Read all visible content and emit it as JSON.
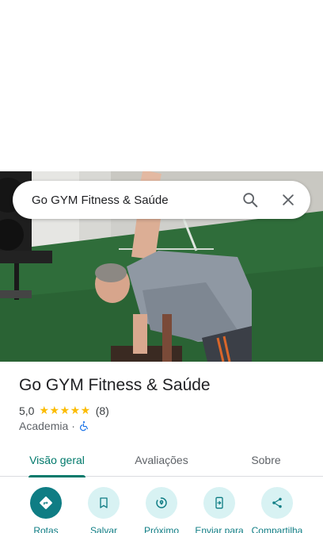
{
  "search": {
    "query": "Go GYM Fitness & Saúde",
    "search_icon": "search-icon",
    "close_icon": "close-icon"
  },
  "place": {
    "name": "Go GYM Fitness & Saúde",
    "rating": "5,0",
    "stars": "★★★★★",
    "review_count": "(8)",
    "category": "Academia",
    "separator": "·",
    "accessibility_icon": "wheelchair-icon"
  },
  "tabs": [
    {
      "label": "Visão geral",
      "active": true
    },
    {
      "label": "Avaliações",
      "active": false
    },
    {
      "label": "Sobre",
      "active": false
    }
  ],
  "actions": [
    {
      "label": "Rotas",
      "icon": "directions-icon"
    },
    {
      "label": "Salvar",
      "icon": "bookmark-icon"
    },
    {
      "label": "Próximo",
      "icon": "nearby-icon"
    },
    {
      "label": "Enviar para",
      "icon": "send-to-phone-icon"
    },
    {
      "label": "Compartilha",
      "icon": "share-icon"
    }
  ],
  "colors": {
    "accent": "#0f7d84",
    "tab_active": "#00796b",
    "star": "#fbbc04",
    "accessibility": "#1a73e8"
  }
}
